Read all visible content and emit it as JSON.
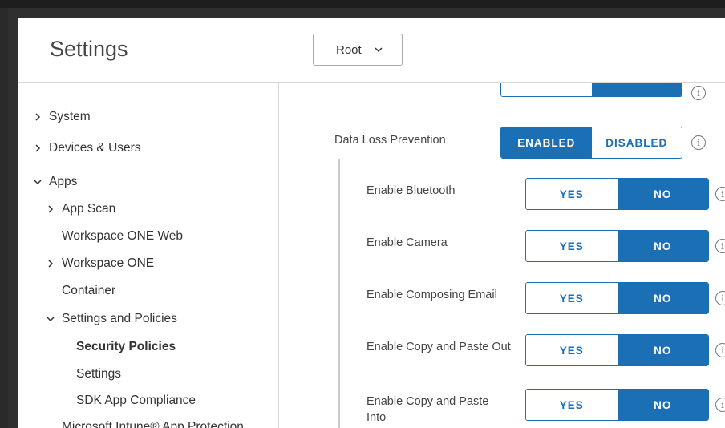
{
  "header": {
    "title": "Settings",
    "org_selector": {
      "value": "Root"
    }
  },
  "sidebar": {
    "items": [
      {
        "label": "System",
        "arrow": "chevron-right"
      },
      {
        "label": "Devices & Users",
        "arrow": "chevron-right"
      },
      {
        "label": "Apps",
        "arrow": "chevron-down"
      },
      {
        "label": "App Scan",
        "arrow": "chevron-right"
      },
      {
        "label": "Workspace ONE Web",
        "arrow": ""
      },
      {
        "label": "Workspace ONE",
        "arrow": "chevron-right"
      },
      {
        "label": "Container",
        "arrow": ""
      },
      {
        "label": "Settings and Policies",
        "arrow": "chevron-down"
      },
      {
        "label": "Security Policies",
        "arrow": "",
        "selected": true
      },
      {
        "label": "Settings",
        "arrow": ""
      },
      {
        "label": "SDK App Compliance",
        "arrow": ""
      },
      {
        "label": "Microsoft Intune® App Protection",
        "arrow": ""
      }
    ]
  },
  "main": {
    "dlp": {
      "label": "Data Loss Prevention",
      "enabled_label": "ENABLED",
      "disabled_label": "DISABLED",
      "selected": "ENABLED"
    },
    "toggles": [
      {
        "label": "Enable Bluetooth",
        "yes": "YES",
        "no": "NO",
        "selected": "NO"
      },
      {
        "label": "Enable Camera",
        "yes": "YES",
        "no": "NO",
        "selected": "NO"
      },
      {
        "label": "Enable Composing Email",
        "yes": "YES",
        "no": "NO",
        "selected": "NO"
      },
      {
        "label": "Enable Copy and Paste Out",
        "yes": "YES",
        "no": "NO",
        "selected": "NO"
      },
      {
        "label": "Enable Copy and Paste Into",
        "yes": "YES",
        "no": "NO",
        "selected": "NO"
      }
    ],
    "info_glyph": "i"
  },
  "colors": {
    "accent": "#1b6fb5",
    "border": "#d7d7d7",
    "guide_line": "#c8ccd0"
  }
}
